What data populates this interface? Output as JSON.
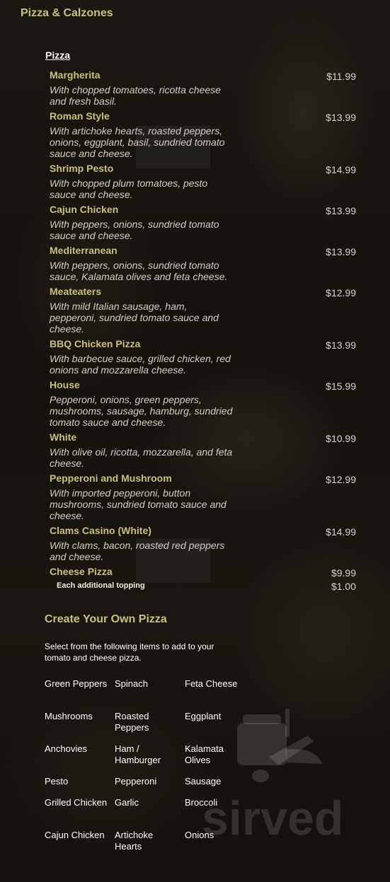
{
  "section_title": "Pizza & Calzones",
  "subsection_title": "Pizza",
  "items": [
    {
      "name": "Margherita",
      "price": "$11.99",
      "description": "With chopped tomatoes, ricotta cheese and fresh basil."
    },
    {
      "name": "Roman Style",
      "price": "$13.99",
      "description": "With artichoke hearts, roasted peppers, onions, eggplant, basil, sundried tomato sauce and cheese."
    },
    {
      "name": "Shrimp Pesto",
      "price": "$14.99",
      "description": "With chopped plum tomatoes, pesto sauce and cheese."
    },
    {
      "name": "Cajun Chicken",
      "price": "$13.99",
      "description": "With peppers, onions, sundried tomato sauce and cheese."
    },
    {
      "name": "Mediterranean",
      "price": "$13.99",
      "description": "With peppers, onions, sundried tomato sauce, Kalamata olives and feta cheese."
    },
    {
      "name": "Meateaters",
      "price": "$12.99",
      "description": "With mild Italian sausage, ham, pepperoni, sundried tomato sauce and cheese."
    },
    {
      "name": "BBQ Chicken Pizza",
      "price": "$13.99",
      "description": "With barbecue sauce, grilled chicken, red onions and mozzarella cheese."
    },
    {
      "name": "House",
      "price": "$15.99",
      "description": "Pepperoni, onions, green peppers, mushrooms, sausage, hamburg, sundried tomato sauce and cheese."
    },
    {
      "name": "White",
      "price": "$10.99",
      "description": "With olive oil, ricotta, mozzarella, and feta cheese."
    },
    {
      "name": "Pepperoni and Mushroom",
      "price": "$12.99",
      "description": "With imported pepperoni, button mushrooms, sundried tomato sauce and cheese."
    },
    {
      "name": "Clams Casino (White)",
      "price": "$14.99",
      "description": "With clams, bacon, roasted red peppers and cheese."
    },
    {
      "name": "Cheese Pizza",
      "price": "$9.99",
      "description": ""
    }
  ],
  "additional_topping": {
    "label": "Each additional topping",
    "price": "$1.00"
  },
  "create_your_own": {
    "title": "Create Your Own Pizza",
    "description": "Select from the following items to add to your tomato and cheese pizza.",
    "toppings": [
      "Green Peppers",
      "Spinach",
      "Feta Cheese",
      "Mushrooms",
      "Roasted Peppers",
      "Eggplant",
      "Anchovies",
      "Ham / Hamburger",
      "Kalamata Olives",
      "Pesto",
      "Pepperoni",
      "Sausage",
      "Grilled Chicken",
      "Garlic",
      "Broccoli",
      "Cajun Chicken",
      "Artichoke Hearts",
      "Onions"
    ]
  },
  "watermark": {
    "text": "sirved",
    "icon": "fork-knife-bag-icon"
  }
}
